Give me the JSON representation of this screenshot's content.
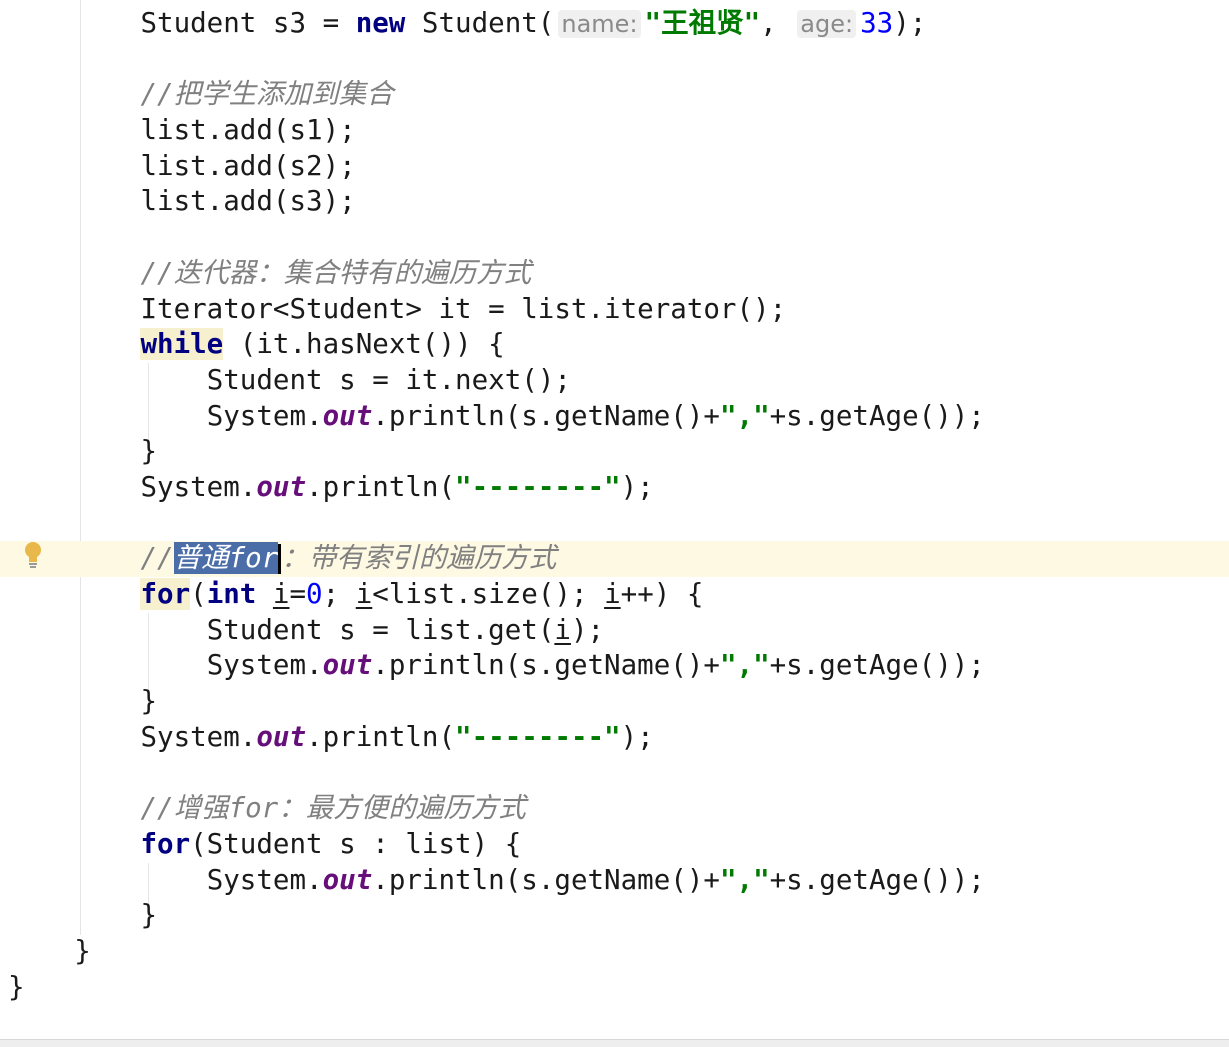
{
  "editor": {
    "current_line_index": 15,
    "lines": [
      {
        "indent": 8,
        "tokens": [
          {
            "t": "plain",
            "s": "Student s3 = "
          },
          {
            "t": "kw",
            "s": "new"
          },
          {
            "t": "plain",
            "s": " Student("
          },
          {
            "t": "hint",
            "s": "name:"
          },
          {
            "t": "str",
            "s": "\"王祖贤\""
          },
          {
            "t": "plain",
            "s": ", "
          },
          {
            "t": "hint",
            "s": "age:"
          },
          {
            "t": "num",
            "s": "33"
          },
          {
            "t": "plain",
            "s": ");"
          }
        ]
      },
      {
        "indent": 0,
        "tokens": []
      },
      {
        "indent": 8,
        "tokens": [
          {
            "t": "cmt",
            "s": "//把学生添加到集合"
          }
        ]
      },
      {
        "indent": 8,
        "tokens": [
          {
            "t": "plain",
            "s": "list.add(s1);"
          }
        ]
      },
      {
        "indent": 8,
        "tokens": [
          {
            "t": "plain",
            "s": "list.add(s2);"
          }
        ]
      },
      {
        "indent": 8,
        "tokens": [
          {
            "t": "plain",
            "s": "list.add(s3);"
          }
        ]
      },
      {
        "indent": 0,
        "tokens": []
      },
      {
        "indent": 8,
        "tokens": [
          {
            "t": "cmt",
            "s": "//迭代器：集合特有的遍历方式"
          }
        ]
      },
      {
        "indent": 8,
        "tokens": [
          {
            "t": "plain",
            "s": "Iterator<Student> it = list.iterator();"
          }
        ]
      },
      {
        "indent": 8,
        "tokens": [
          {
            "t": "kwhl",
            "s": "while"
          },
          {
            "t": "plain",
            "s": " (it.hasNext()) {"
          }
        ]
      },
      {
        "indent": 12,
        "tokens": [
          {
            "t": "plain",
            "s": "Student s = it.next();"
          }
        ]
      },
      {
        "indent": 12,
        "tokens": [
          {
            "t": "plain",
            "s": "System."
          },
          {
            "t": "fld",
            "s": "out"
          },
          {
            "t": "plain",
            "s": ".println(s.getName()+"
          },
          {
            "t": "str",
            "s": "\",\""
          },
          {
            "t": "plain",
            "s": "+s.getAge());"
          }
        ]
      },
      {
        "indent": 8,
        "tokens": [
          {
            "t": "plain",
            "s": "}"
          }
        ]
      },
      {
        "indent": 8,
        "tokens": [
          {
            "t": "plain",
            "s": "System."
          },
          {
            "t": "fld",
            "s": "out"
          },
          {
            "t": "plain",
            "s": ".println("
          },
          {
            "t": "str",
            "s": "\"--------\""
          },
          {
            "t": "plain",
            "s": ");"
          }
        ]
      },
      {
        "indent": 0,
        "tokens": []
      },
      {
        "indent": 8,
        "tokens": [
          {
            "t": "cmt",
            "s": "//"
          },
          {
            "t": "cmtsel",
            "s": "普通for"
          },
          {
            "t": "cursor",
            "s": ""
          },
          {
            "t": "cmt",
            "s": "：带有索引的遍历方式"
          }
        ]
      },
      {
        "indent": 8,
        "tokens": [
          {
            "t": "kwhl",
            "s": "for"
          },
          {
            "t": "plain",
            "s": "("
          },
          {
            "t": "kw",
            "s": "int"
          },
          {
            "t": "plain",
            "s": " "
          },
          {
            "t": "uvar",
            "s": "i"
          },
          {
            "t": "plain",
            "s": "="
          },
          {
            "t": "num",
            "s": "0"
          },
          {
            "t": "plain",
            "s": "; "
          },
          {
            "t": "uvar",
            "s": "i"
          },
          {
            "t": "plain",
            "s": "<list.size(); "
          },
          {
            "t": "uvar",
            "s": "i"
          },
          {
            "t": "plain",
            "s": "++) {"
          }
        ]
      },
      {
        "indent": 12,
        "tokens": [
          {
            "t": "plain",
            "s": "Student s = list.get("
          },
          {
            "t": "uvar",
            "s": "i"
          },
          {
            "t": "plain",
            "s": ");"
          }
        ]
      },
      {
        "indent": 12,
        "tokens": [
          {
            "t": "plain",
            "s": "System."
          },
          {
            "t": "fld",
            "s": "out"
          },
          {
            "t": "plain",
            "s": ".println(s.getName()+"
          },
          {
            "t": "str",
            "s": "\",\""
          },
          {
            "t": "plain",
            "s": "+s.getAge());"
          }
        ]
      },
      {
        "indent": 8,
        "tokens": [
          {
            "t": "plain",
            "s": "}"
          }
        ]
      },
      {
        "indent": 8,
        "tokens": [
          {
            "t": "plain",
            "s": "System."
          },
          {
            "t": "fld",
            "s": "out"
          },
          {
            "t": "plain",
            "s": ".println("
          },
          {
            "t": "str",
            "s": "\"--------\""
          },
          {
            "t": "plain",
            "s": ");"
          }
        ]
      },
      {
        "indent": 0,
        "tokens": []
      },
      {
        "indent": 8,
        "tokens": [
          {
            "t": "cmt",
            "s": "//增强for：最方便的遍历方式"
          }
        ]
      },
      {
        "indent": 8,
        "tokens": [
          {
            "t": "kw",
            "s": "for"
          },
          {
            "t": "plain",
            "s": "(Student s : list) {"
          }
        ]
      },
      {
        "indent": 12,
        "tokens": [
          {
            "t": "plain",
            "s": "System."
          },
          {
            "t": "fld",
            "s": "out"
          },
          {
            "t": "plain",
            "s": ".println(s.getName()+"
          },
          {
            "t": "str",
            "s": "\",\""
          },
          {
            "t": "plain",
            "s": "+s.getAge());"
          }
        ]
      },
      {
        "indent": 8,
        "tokens": [
          {
            "t": "plain",
            "s": "}"
          }
        ]
      },
      {
        "indent": 4,
        "tokens": [
          {
            "t": "plain",
            "s": "}"
          }
        ]
      },
      {
        "indent": 0,
        "tokens": [
          {
            "t": "plain",
            "s": "}"
          }
        ]
      }
    ]
  },
  "gutter": {
    "intention_icon": "lightbulb-icon",
    "icon_color": "#e8b84a"
  },
  "colors": {
    "keyword": "#000080",
    "string": "#007a00",
    "comment": "#808080",
    "selection": "#4c6ea8",
    "caret_line": "#fdf9e3"
  }
}
